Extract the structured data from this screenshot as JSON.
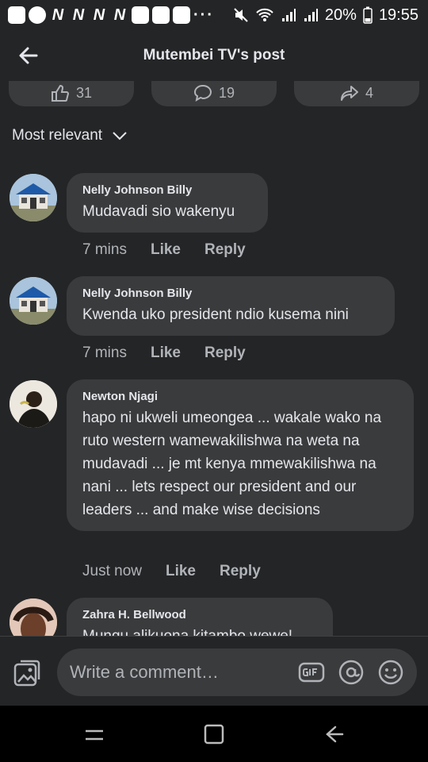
{
  "status_bar": {
    "battery": "20%",
    "time": "19:55",
    "icons": [
      "chat-icon",
      "facebook-icon",
      "n-icon",
      "n-icon",
      "n-icon",
      "n-icon",
      "gallery-icon",
      "gallery-icon",
      "gallery-icon",
      "more-icon",
      "mute-icon",
      "wifi-icon",
      "signal-icon",
      "signal-icon",
      "battery-icon"
    ],
    "n_glyph": "N"
  },
  "header": {
    "title": "Mutembei TV's post"
  },
  "reactions": {
    "like_count": "31",
    "comment_count": "19",
    "share_count": "4"
  },
  "sort": {
    "label": "Most relevant"
  },
  "comments": [
    {
      "author": "Nelly Johnson Billy",
      "text": "Mudavadi sio wakenyu",
      "time": "7 mins",
      "like": "Like",
      "reply": "Reply"
    },
    {
      "author": "Nelly Johnson Billy",
      "text": "Kwenda uko president ndio kusema nini",
      "time": "7 mins",
      "like": "Like",
      "reply": "Reply"
    },
    {
      "author": "Newton Njagi",
      "text": "hapo ni ukweli umeongea ... wakale wako na ruto western wamewakilishwa na weta na mudavadi ... je mt kenya mmewakilishwa na nani ... lets respect our president and our leaders ... and make wise  decisions",
      "time": "Just now",
      "like": "Like",
      "reply": "Reply"
    },
    {
      "author": "Zahra H. Bellwood",
      "text": "Mungu alikuona kitambo wewe!"
    }
  ],
  "composer": {
    "placeholder": "Write a comment…"
  },
  "colors": {
    "background": "#242526",
    "bubble": "#3a3b3c",
    "text": "#e4e6eb",
    "muted": "#b0b3b8"
  }
}
